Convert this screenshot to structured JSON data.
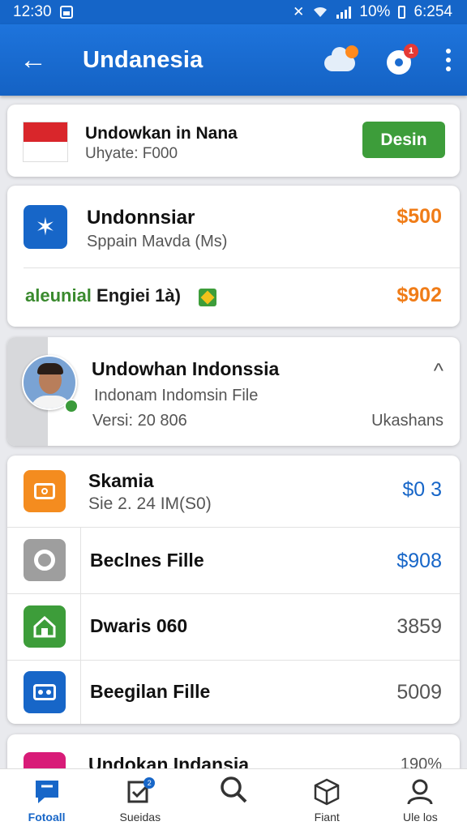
{
  "status_bar": {
    "time_left": "12:30",
    "battery": "10%",
    "time_right": "6:254"
  },
  "app_bar": {
    "title": "Undanesia",
    "notification_count": "1"
  },
  "promo": {
    "title": "Undowkan in Nana",
    "subtitle": "Uhyate: F000",
    "button": "Desin"
  },
  "group1": {
    "rows": [
      {
        "title": "Undonnsiar",
        "subtitle": "Sppain Mavda (Ms)",
        "price": "$500"
      },
      {
        "title_green": "aleunial",
        "title": " Engiei 1à)",
        "price": "$902"
      }
    ]
  },
  "profile": {
    "name": "Undowhan Indonssia",
    "line2": "Indonam Indomsin File",
    "version": "Versi: 20 806",
    "meta": "Ukashans"
  },
  "group2": {
    "rows": [
      {
        "title": "Skamia",
        "subtitle": "Sie 2. 24 IM(S0)",
        "price": "$0 3",
        "icon": "camera-icon",
        "color": "#f48c1f"
      },
      {
        "title": "Beclnes Fille",
        "price": "$908",
        "icon": "settings-icon",
        "color": "#9e9e9e"
      },
      {
        "title": "Dwaris 060",
        "price": "3859",
        "icon": "home-icon",
        "color": "#3d9d3a"
      },
      {
        "title": "Beegilan Fille",
        "price": "5009",
        "icon": "radio-icon",
        "color": "#1766c8"
      }
    ]
  },
  "partial": {
    "title": "Undokan Indansia",
    "value": "190%"
  },
  "bottom_nav": [
    {
      "label": "Fotoall",
      "icon": "chat-icon"
    },
    {
      "label": "Sueidas",
      "icon": "edit-check-icon",
      "badge": "2"
    },
    {
      "label": "",
      "icon": "search-icon"
    },
    {
      "label": "Fiant",
      "icon": "box-icon"
    },
    {
      "label": "Ule los",
      "icon": "person-icon"
    }
  ]
}
